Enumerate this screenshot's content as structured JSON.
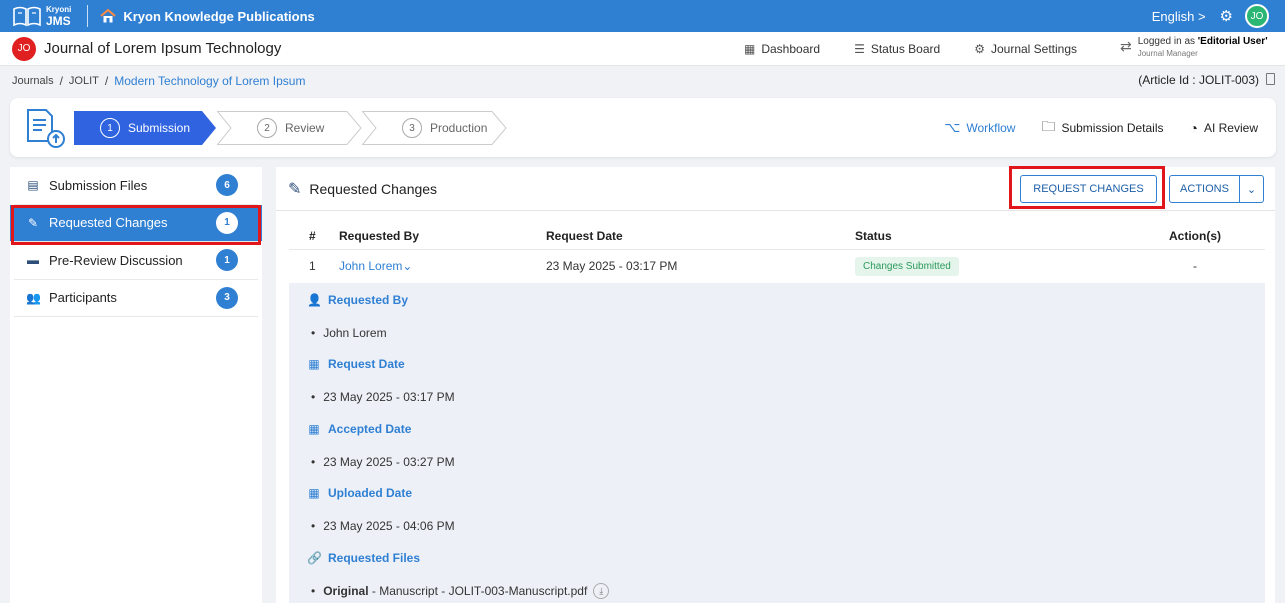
{
  "topbar": {
    "logo_small": "Kryoni",
    "logo_big": "JMS",
    "publication": "Kryon Knowledge Publications",
    "language": "English >",
    "avatar": "JO"
  },
  "journalbar": {
    "badge": "JO",
    "title": "Journal of Lorem Ipsum Technology",
    "nav": [
      "Dashboard",
      "Status Board",
      "Journal Settings"
    ],
    "login_prefix": "Logged in as ",
    "login_role": "'Editorial User'",
    "login_subrole": "Journal Manager"
  },
  "breadcrumb": {
    "items": [
      "Journals",
      "JOLIT"
    ],
    "current": "Modern Technology of Lorem Ipsum",
    "article_id": "(Article Id : JOLIT-003)"
  },
  "workflow": {
    "steps": [
      {
        "num": "1",
        "label": "Submission"
      },
      {
        "num": "2",
        "label": "Review"
      },
      {
        "num": "3",
        "label": "Production"
      }
    ],
    "tabs": [
      "Workflow",
      "Submission Details",
      "AI Review"
    ]
  },
  "sidebar": {
    "items": [
      {
        "label": "Submission Files",
        "count": "6"
      },
      {
        "label": "Requested Changes",
        "count": "1"
      },
      {
        "label": "Pre-Review Discussion",
        "count": "1"
      },
      {
        "label": "Participants",
        "count": "3"
      }
    ]
  },
  "main": {
    "title": "Requested Changes",
    "request_button": "REQUEST CHANGES",
    "actions_button": "ACTIONS",
    "table": {
      "headers": [
        "#",
        "Requested By",
        "Request Date",
        "Status",
        "Action(s)"
      ],
      "rows": [
        {
          "num": "1",
          "by": "John Lorem",
          "date": "23 May 2025 - 03:17 PM",
          "status": "Changes Submitted",
          "action": "-"
        }
      ]
    },
    "details": {
      "requested_by_label": "Requested By",
      "requested_by": "John Lorem",
      "request_date_label": "Request Date",
      "request_date": "23 May 2025 - 03:17 PM",
      "accepted_date_label": "Accepted Date",
      "accepted_date": "23 May 2025 - 03:27 PM",
      "uploaded_date_label": "Uploaded Date",
      "uploaded_date": "23 May 2025 - 04:06 PM",
      "requested_files_label": "Requested Files",
      "file_kind": "Original",
      "file_desc": " - Manuscript - JOLIT-003-Manuscript.pdf"
    }
  },
  "colors": {
    "brand": "#2f7fd3",
    "highlight": "#e0161b",
    "status_green": "#2a9a5a"
  }
}
